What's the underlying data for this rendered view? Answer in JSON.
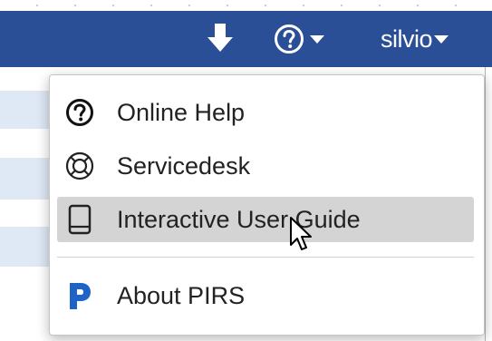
{
  "navbar": {
    "download_icon": "download-arrow-icon",
    "help_icon": "question-circle-icon",
    "user_name": "silvio",
    "background": "#2a4f96"
  },
  "help_menu": {
    "items": [
      {
        "label": "Online Help",
        "icon": "question-circle-icon"
      },
      {
        "label": "Servicedesk",
        "icon": "lifebuoy-icon"
      },
      {
        "label": "Interactive User Guide",
        "icon": "book-icon",
        "highlighted": true
      },
      {
        "label": "About PIRS",
        "icon": "pirs-logo-icon"
      }
    ],
    "highlight_color": "#d4d4d4",
    "brand_color": "#1f63c6"
  }
}
